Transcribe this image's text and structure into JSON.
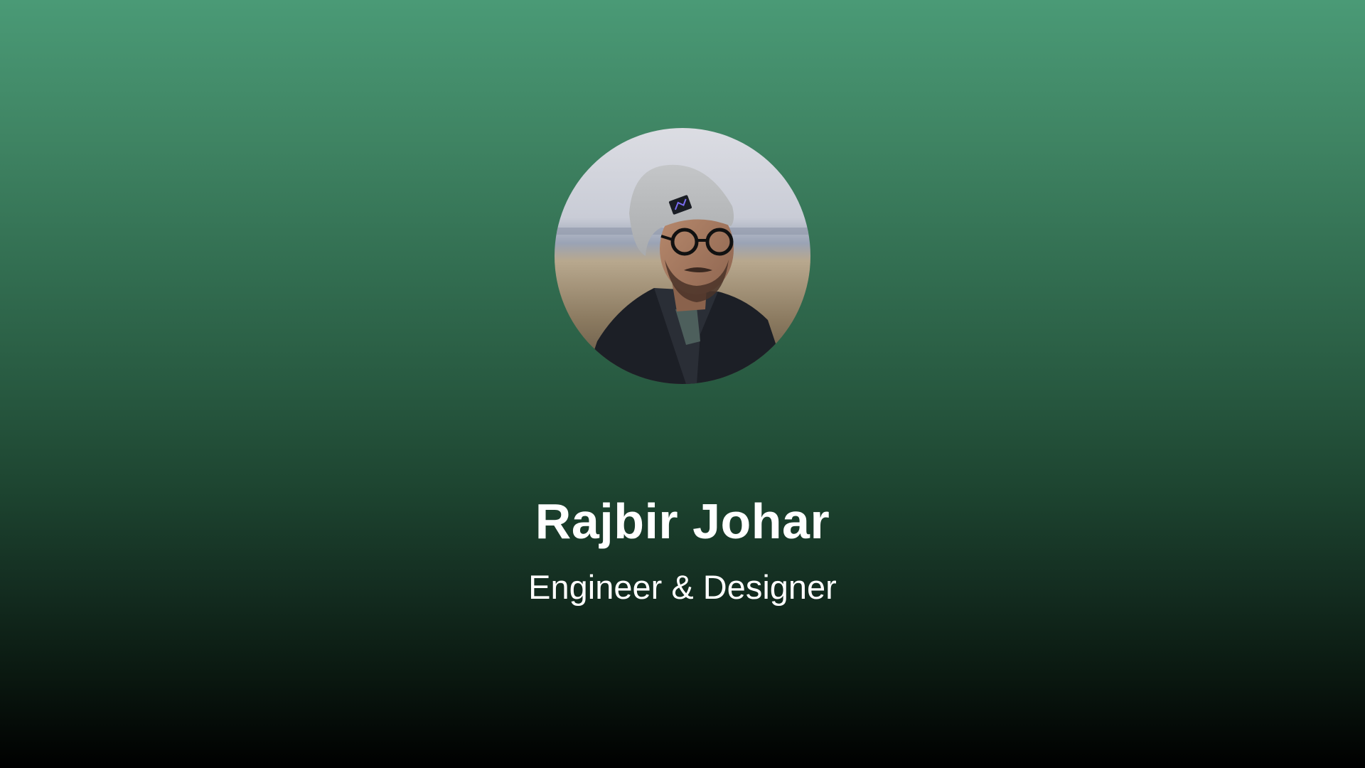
{
  "profile": {
    "name": "Rajbir Johar",
    "role": "Engineer & Designer",
    "avatar_icon": "profile-photo-avatar"
  },
  "theme": {
    "gradient_top": "#4a9a76",
    "gradient_bottom": "#000000",
    "text_color": "#ffffff"
  }
}
